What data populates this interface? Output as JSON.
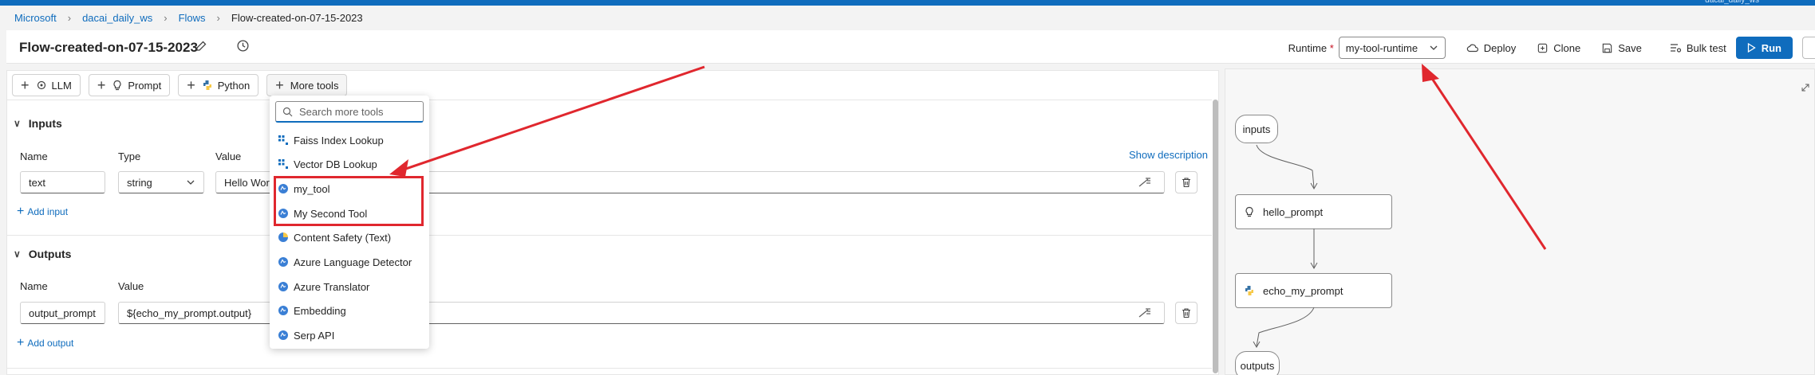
{
  "topbar": {
    "workspace_hint": "dacai_daily_ws"
  },
  "breadcrumb": {
    "items": [
      "Microsoft",
      "dacai_daily_ws",
      "Flows"
    ],
    "current": "Flow-created-on-07-15-2023"
  },
  "header": {
    "title": "Flow-created-on-07-15-2023",
    "runtime_label": "Runtime",
    "runtime_required": "*",
    "runtime_value": "my-tool-runtime",
    "deploy": "Deploy",
    "clone": "Clone",
    "save": "Save",
    "bulk_test": "Bulk test",
    "run": "Run"
  },
  "toolbar": {
    "llm": "LLM",
    "prompt": "Prompt",
    "python": "Python",
    "more_tools": "More tools"
  },
  "inputs": {
    "title": "Inputs",
    "col_name": "Name",
    "col_type": "Type",
    "col_value": "Value",
    "show_description": "Show description",
    "row": {
      "name": "text",
      "type": "string",
      "value": "Hello World!"
    },
    "add": "Add input"
  },
  "outputs": {
    "title": "Outputs",
    "col_name": "Name",
    "col_value": "Value",
    "row": {
      "name": "output_prompt",
      "value": "${echo_my_prompt.output}"
    },
    "add": "Add output"
  },
  "dropdown": {
    "placeholder": "Search more tools",
    "items": [
      {
        "label": "Faiss Index Lookup",
        "icon": "grid-icon"
      },
      {
        "label": "Vector DB Lookup",
        "icon": "grid-icon"
      },
      {
        "label": "my_tool",
        "icon": "azure-icon"
      },
      {
        "label": "My Second Tool",
        "icon": "azure-icon"
      },
      {
        "label": "Content Safety (Text)",
        "icon": "content-safety-icon"
      },
      {
        "label": "Azure Language Detector",
        "icon": "azure-icon"
      },
      {
        "label": "Azure Translator",
        "icon": "azure-icon"
      },
      {
        "label": "Embedding",
        "icon": "azure-icon"
      },
      {
        "label": "Serp API",
        "icon": "azure-icon"
      }
    ]
  },
  "graph": {
    "inputs": "inputs",
    "node1": "hello_prompt",
    "node2": "echo_my_prompt",
    "outputs": "outputs"
  },
  "colors": {
    "accent": "#0f6cbd",
    "annotation": "#e0272e"
  }
}
